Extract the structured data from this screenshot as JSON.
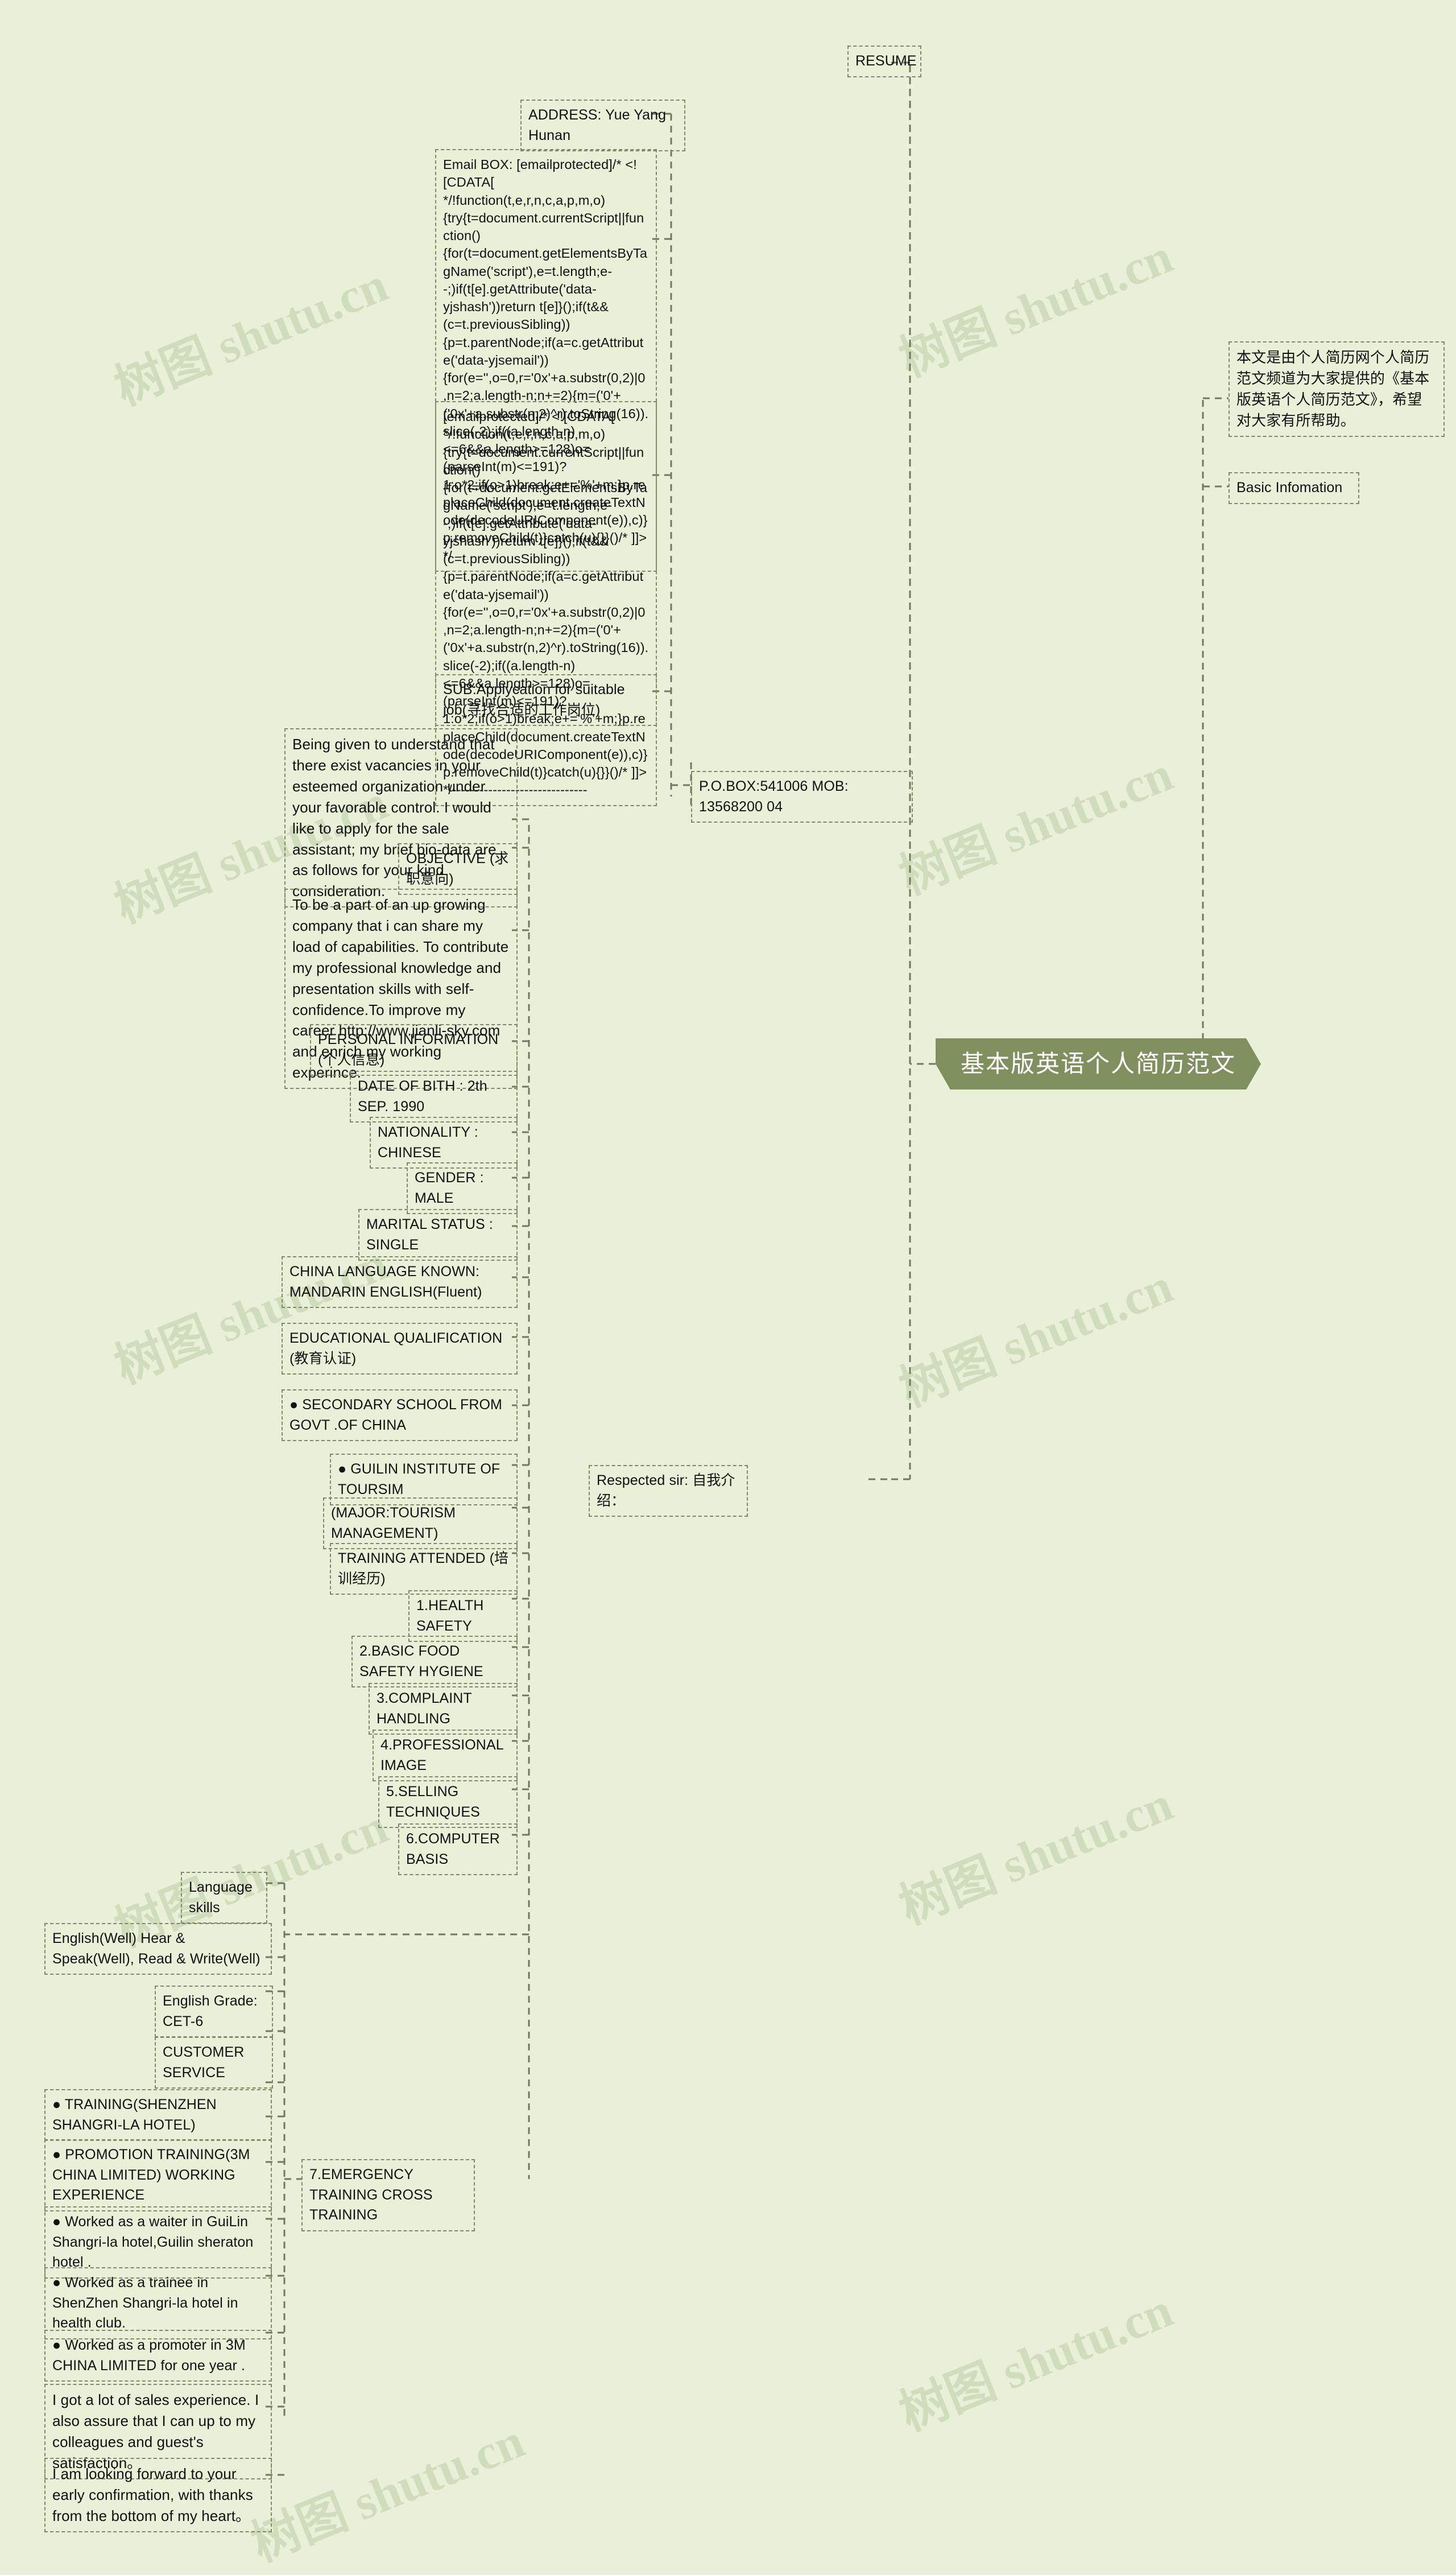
{
  "meta": {
    "bg_color": "#e8f0d8",
    "root_color": "#7f8f5e",
    "node_border_color": "#7d8a66",
    "watermark_text": "树图 shutu.cn"
  },
  "root": {
    "label": "基本版英语个人简历范文"
  },
  "right_branch": {
    "intro": "本文是由个人简历网个人简历范文频道为大家提供的《基本版英语个人简历范文》，希望对大家有所帮助。",
    "basic_information": "Basic Infomation"
  },
  "left_branch": {
    "resume": "RESUME",
    "address": "ADDRESS: Yue Yang Hunan",
    "email_box": "Email BOX: [emailprotected]/* <![CDATA[ */!function(t,e,r,n,c,a,p,m,o){try{t=document.currentScript||function(){for(t=document.getElementsByTagName('script'),e=t.length;e--;)if(t[e].getAttribute('data-yjshash'))return t[e]}();if(t&&(c=t.previousSibling)){p=t.parentNode;if(a=c.getAttribute('data-yjsemail')){for(e='',o=0,r='0x'+a.substr(0,2)|0,n=2;a.length-n;n+=2){m=('0'+('0x'+a.substr(n,2)^r).toString(16)).slice(-2);if((a.length-n)<=6&&a.length>=128)o=(parseInt(m)<=191)?1:o*2;if(o>1)break;e+='%'+m;}p.replaceChild(document.createTextNode(decodeURIComponent(e)),c)}p.removeChild(t)}catch(u){}}()/* ]]> */",
    "email_box_2": "[emailprotected]/* <![CDATA[ */!function(t,e,r,n,c,a,p,m,o){try{t=document.currentScript||function(){for(t=document.getElementsByTagName('script'),e=t.length;e--;)if(t[e].getAttribute('data-yjshash'))return t[e]}();if(t&&(c=t.previousSibling)){p=t.parentNode;if(a=c.getAttribute('data-yjsemail')){for(e='',o=0,r='0x'+a.substr(0,2)|0,n=2;a.length-n;n+=2){m=('0'+('0x'+a.substr(n,2)^r).toString(16)).slice(-2);if((a.length-n)<=6&&a.length>=128)o=(parseInt(m)<=191)?1:o*2;if(o>1)break;e+='%'+m;}p.replaceChild(document.createTextNode(decodeURIComponent(e)),c)}p.removeChild(t)}catch(u){}}()/* ]]> */------------------------------",
    "subject": "SUB:Applycation for suitable job(寻找合适的工作岗位)",
    "pobox": "P.O.BOX:541006 MOB: 13568200 04",
    "respected_sir": "Respected sir: 自我介绍：",
    "intro_paragraph": "Being given to understand that there exist vacancies in your esteemed organization under your favorable control. I would like to apply for the sale assistant; my brief bio-data are as follows for your kind consideration.",
    "objective_label": "OBJECTIVE (求职意向)",
    "objective_text": "To be a part of an up growing company that i can share my load of capabilities. To contribute my professional knowledge and presentation skills with self-confidence.To improve my career http://www.jianli-sky.com and enrich my working experince.",
    "personal_information_label": "PERSONAL INFORMATION (个人信息)",
    "personal_information": [
      "DATE OF BITH : 2th SEP. 1990",
      "NATIONALITY : CHINESE",
      "GENDER : MALE",
      "MARITAL STATUS : SINGLE",
      "CHINA LANGUAGE KNOWN: MANDARIN ENGLISH(Fluent)"
    ],
    "educational_qualification_label": "EDUCATIONAL QUALIFICATION (教育认证)",
    "education": [
      "● SECONDARY SCHOOL FROM GOVT .OF CHINA",
      "● GUILIN INSTITUTE OF TOURSIM",
      "(MAJOR:TOURISM MANAGEMENT)"
    ],
    "training_attended_label": "TRAINING ATTENDED (培训经历)",
    "training": [
      "1.HEALTH SAFETY",
      "2.BASIC FOOD SAFETY HYGIENE",
      "3.COMPLAINT HANDLING",
      "4.PROFESSIONAL IMAGE",
      "5.SELLING TECHNIQUES",
      "6.COMPUTER BASIS",
      "7.EMERGENCY TRAINING CROSS TRAINING"
    ],
    "language_skills_label": "Language skills",
    "language_skills": [
      "English(Well) Hear & Speak(Well), Read & Write(Well)",
      "English Grade: CET-6",
      "CUSTOMER SERVICE"
    ],
    "experience": [
      "● TRAINING(SHENZHEN SHANGRI-LA HOTEL)",
      "● PROMOTION TRAINING(3M CHINA LIMITED) WORKING EXPERIENCE",
      "● Worked as a waiter in GuiLin Shangri-la hotel,Guilin sheraton hotel .",
      "● Worked as a trainee in ShenZhen Shangri-la hotel in health club.",
      "● Worked as a promoter in 3M CHINA LIMITED for one year .",
      "I got a lot of sales experience. I also assure that I can up to my colleagues and guest's satisfaction。",
      "I am looking forward to your early confirmation, with thanks from the bottom of my heart。"
    ]
  }
}
